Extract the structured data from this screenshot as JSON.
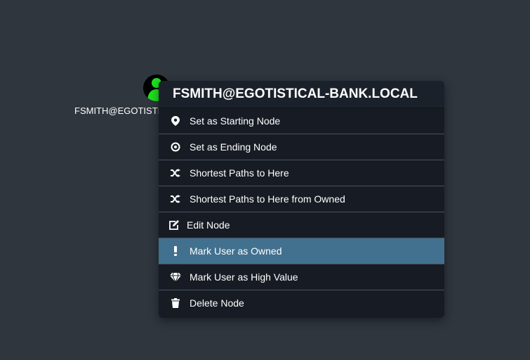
{
  "node": {
    "label": "FSMITH@EGOTISTICAL-BANK.LOCAL",
    "icon": "user-icon",
    "icon_color": "#20e020"
  },
  "menu": {
    "title": "FSMITH@EGOTISTICAL-BANK.LOCAL",
    "items": [
      {
        "label": "Set as Starting Node",
        "icon": "map-marker-icon"
      },
      {
        "label": "Set as Ending Node",
        "icon": "bullseye-icon"
      },
      {
        "label": "Shortest Paths to Here",
        "icon": "random-icon"
      },
      {
        "label": "Shortest Paths to Here from Owned",
        "icon": "random-icon"
      },
      {
        "label": "Edit Node",
        "icon": "edit-icon"
      },
      {
        "label": "Mark User as Owned",
        "icon": "exclamation-icon",
        "active": true
      },
      {
        "label": "Mark User as High Value",
        "icon": "gem-icon"
      },
      {
        "label": "Delete Node",
        "icon": "trash-icon"
      }
    ],
    "active_color": "#42718f"
  }
}
